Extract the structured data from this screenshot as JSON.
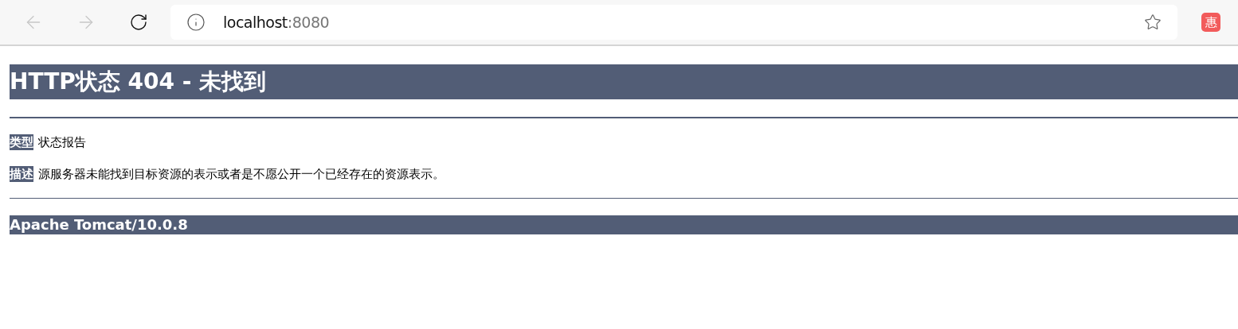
{
  "toolbar": {
    "back": {
      "disabled": true
    },
    "forward": {
      "disabled": true
    },
    "address": {
      "host": "localhost",
      "port": ":8080"
    },
    "extension_badge": "惠"
  },
  "page": {
    "title": "HTTP状态 404 - 未找到",
    "fields": [
      {
        "label": "类型",
        "value": "状态报告"
      },
      {
        "label": "描述",
        "value": "源服务器未能找到目标资源的表示或者是不愿公开一个已经存在的资源表示。"
      }
    ],
    "footer": "Apache Tomcat/10.0.8"
  }
}
